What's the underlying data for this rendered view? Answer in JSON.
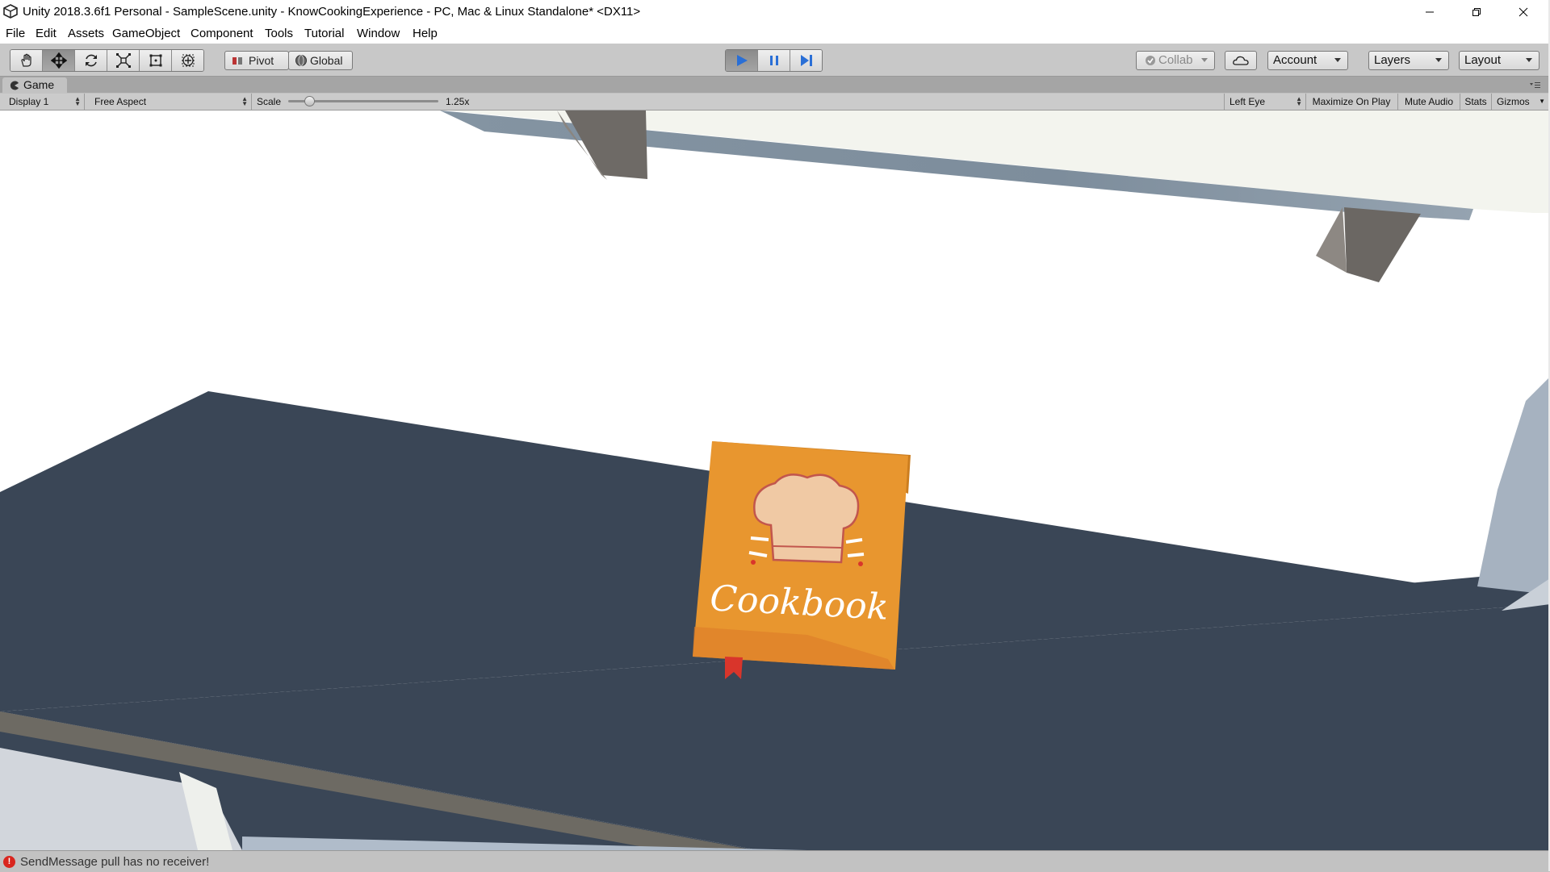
{
  "window": {
    "title": "Unity 2018.3.6f1 Personal - SampleScene.unity - KnowCookingExperience - PC, Mac & Linux Standalone* <DX11>",
    "minimize_icon": "minimize-icon",
    "maximize_icon": "restore-icon",
    "close_icon": "close-icon"
  },
  "menu": {
    "items": [
      "File",
      "Edit",
      "Assets",
      "GameObject",
      "Component",
      "Tools",
      "Tutorial",
      "Window",
      "Help"
    ]
  },
  "toolbar": {
    "transform_tools": [
      "hand-icon",
      "move-icon",
      "rotate-icon",
      "scale-icon",
      "rect-tool-icon",
      "transform-tool-icon"
    ],
    "active_tool": "move-icon",
    "pivot_label": "Pivot",
    "global_label": "Global",
    "play_active": true,
    "collab_label": "Collab",
    "account_label": "Account",
    "layers_label": "Layers",
    "layout_label": "Layout",
    "accent_color": "#2a6fd6"
  },
  "game_panel": {
    "tab_label": "Game",
    "display": "Display 1",
    "aspect": "Free Aspect",
    "scale_label": "Scale",
    "scale_value": "1.25x",
    "scale_fraction": 0.14,
    "eye": "Left Eye",
    "maximize_on_play": "Maximize On Play",
    "mute_audio": "Mute Audio",
    "stats": "Stats",
    "gizmos": "Gizmos"
  },
  "scene": {
    "cookbook_text": "Cookbook",
    "book_color": "#e8962f",
    "counter_color": "#3a4656"
  },
  "status": {
    "message": "SendMessage pull has no receiver!",
    "error_color": "#d9251d"
  }
}
